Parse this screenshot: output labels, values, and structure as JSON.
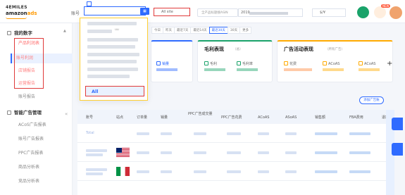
{
  "brand": {
    "line1": "4EMILES",
    "line2a": "amazon",
    "line2b": "ads"
  },
  "header": {
    "shop_label": "账号",
    "shop_value": "账",
    "site_placeholder": "All site",
    "asin_placeholder": "全产品标题搜ASIN",
    "date_value": "2019",
    "currency_value": "$/¥",
    "notif_badge": "NEW"
  },
  "dropdown": {
    "selected": "All",
    "item_text": "uu"
  },
  "sidebar": {
    "group1": "我的数字",
    "group2": "智能广告管理",
    "items": [
      {
        "label": "产品利润表"
      },
      {
        "label": "账号利润"
      },
      {
        "label": "店铺报告"
      },
      {
        "label": "运营报告"
      },
      {
        "label": "账号报告"
      },
      {
        "label": "ACoS广告报表"
      },
      {
        "label": "账号广告报表"
      },
      {
        "label": "PPC广告报表"
      },
      {
        "label": "商品分析表"
      },
      {
        "label": "竞品分析表"
      }
    ]
  },
  "tabs": [
    "今日",
    "昨天",
    "最近7天",
    "最近14天",
    "最近30天",
    "30天",
    "更多"
  ],
  "tabs_active_index": 4,
  "cards": {
    "left": {
      "kpi_label": "销量"
    },
    "profit": {
      "title": "毛利表现",
      "sub": "（总）",
      "kpi1": "毛利",
      "kpi2": "毛利率"
    },
    "ads": {
      "title": "广告活动表现",
      "sub": "（所有广告）",
      "kpi1": "花费",
      "kpi2": "ACoAS",
      "kpi3": "ACoAS"
    }
  },
  "add_button": "添加广告账",
  "table": {
    "headers": [
      "账号",
      "站点",
      "订单量",
      "销量",
      "PPC广告成交量",
      "PPC广告花费",
      "ACoAS",
      "ASoAS",
      "销售额",
      "FBA费用",
      "退款"
    ],
    "rows": [
      {
        "shop": "Total",
        "flag": ""
      },
      {
        "shop": "店铺",
        "flag": "us"
      },
      {
        "shop": "店铺",
        "flag": "it"
      }
    ]
  },
  "colors": {
    "accent": "#2f6bff",
    "highlight_red": "#e03a3a",
    "highlight_yellow": "#ffcf33",
    "green": "#1aa36a",
    "orange": "#ffaa00"
  }
}
